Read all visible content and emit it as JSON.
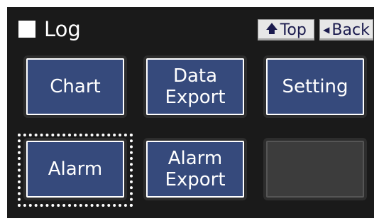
{
  "header": {
    "title": "Log",
    "top_button": {
      "label": "Top",
      "icon": "up-arrow-icon"
    },
    "back_button": {
      "label": "Back",
      "icon": "left-triangle-icon"
    }
  },
  "menu": {
    "chart": {
      "label": "Chart"
    },
    "data_export": {
      "line1": "Data",
      "line2": "Export"
    },
    "setting": {
      "label": "Setting"
    },
    "alarm": {
      "label": "Alarm",
      "selected": true
    },
    "alarm_export": {
      "line1": "Alarm",
      "line2": "Export"
    }
  },
  "colors": {
    "screen_background": "#1a1a1a",
    "tile_fill": "#364a7c",
    "tile_border": "#ffffff",
    "empty_tile_fill": "#3c3c3c",
    "nav_button_fill": "#e7e7e7",
    "nav_button_text": "#1b1b4e"
  }
}
